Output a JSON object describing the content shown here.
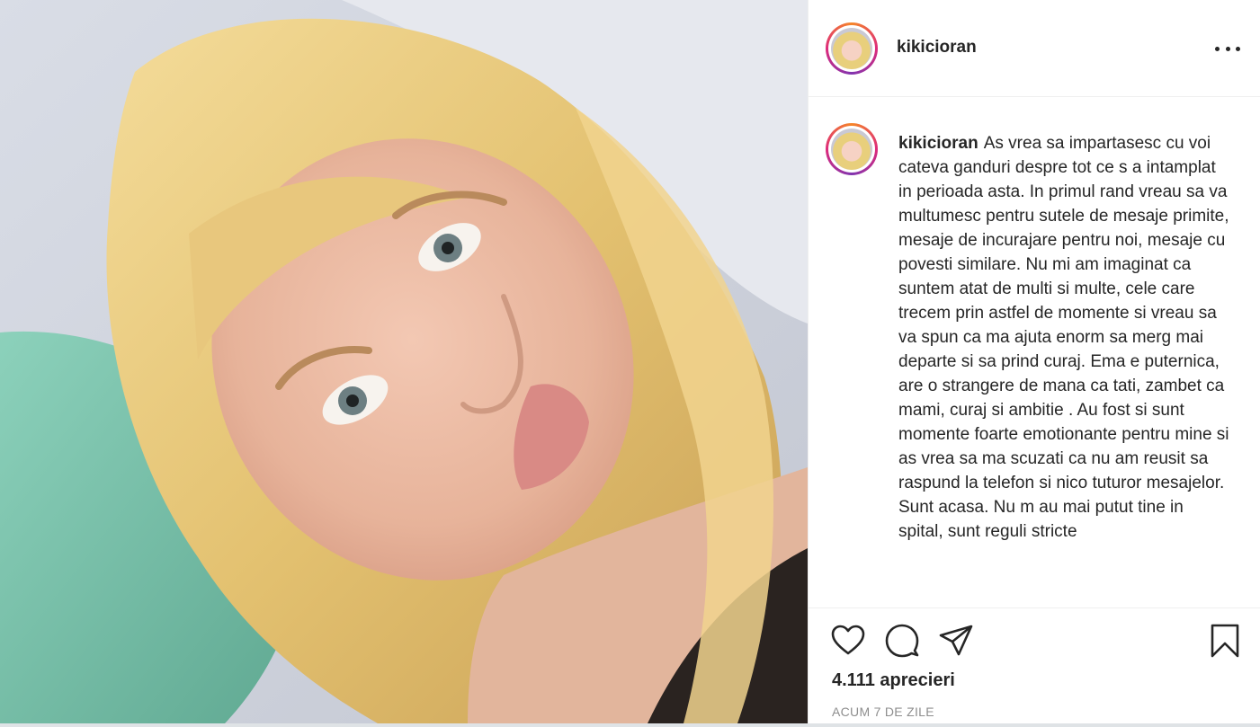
{
  "post": {
    "username": "kikicioran",
    "caption": "As vrea sa impartasesc cu voi cateva ganduri despre tot ce s a intamplat in perioada asta. In primul rand vreau sa va multumesc pentru sutele de mesaje primite, mesaje de incurajare pentru noi, mesaje cu povesti similare. Nu mi am imaginat ca suntem atat de multi si multe, cele care trecem prin astfel de momente si vreau sa va spun ca ma ajuta enorm sa merg mai departe si sa prind curaj. Ema e puternica, are o strangere de mana ca tati, zambet ca mami, curaj si ambitie . Au fost si sunt momente foarte emotionante pentru mine si as vrea sa ma scuzati ca nu am reusit sa raspund la telefon si nico tuturor mesajelor. Sunt acasa. Nu m au mai putut tine in spital, sunt reguli stricte",
    "likes": "4.111 aprecieri",
    "timestamp": "ACUM 7 DE ZILE"
  },
  "icons": {
    "more": "more-options-icon",
    "like": "heart-icon",
    "comment": "comment-bubble-icon",
    "share": "paper-plane-icon",
    "save": "bookmark-icon"
  },
  "colors": {
    "text": "#262626",
    "muted": "#8e8e8e",
    "divider": "#efefef",
    "story_ring_start": "#f58529",
    "story_ring_mid": "#dd2a7b"
  }
}
